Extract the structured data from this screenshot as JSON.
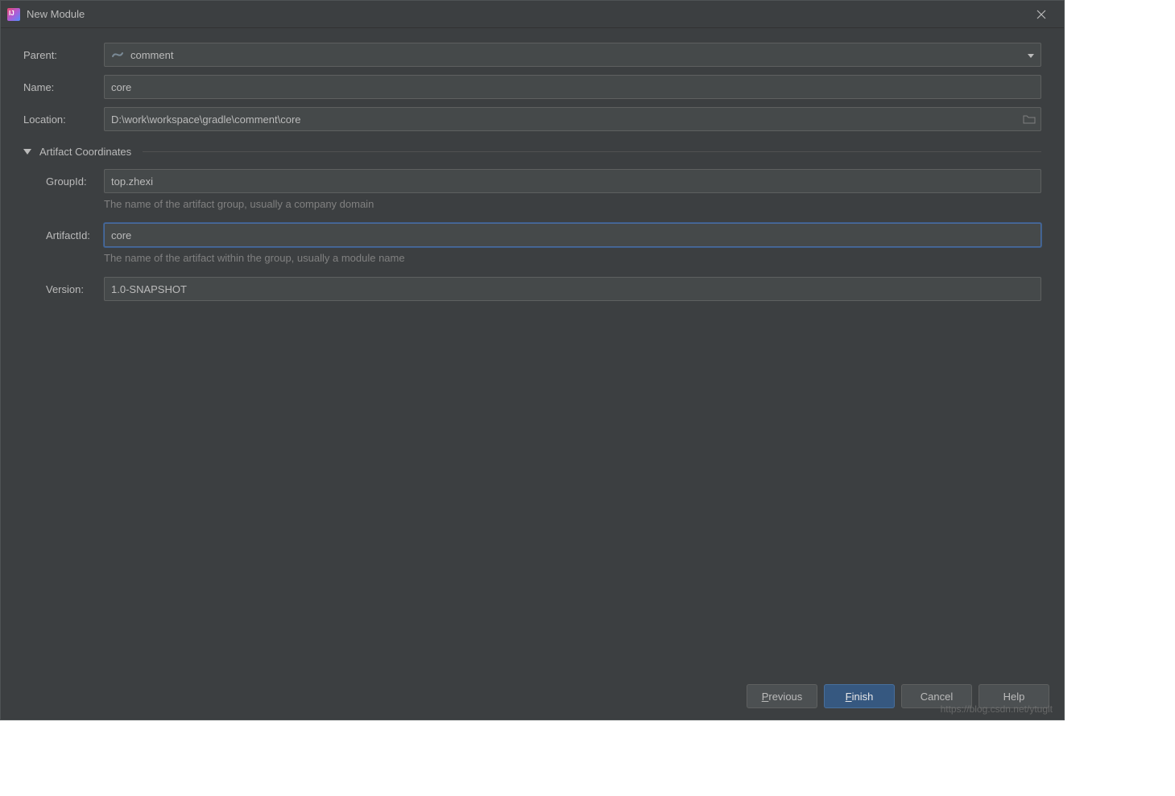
{
  "titlebar": {
    "title": "New Module"
  },
  "form": {
    "parent_label": "Parent:",
    "parent_value": "comment",
    "name_label": "Name:",
    "name_value": "core",
    "location_label": "Location:",
    "location_value": "D:\\work\\workspace\\gradle\\comment\\core"
  },
  "section": {
    "title": "Artifact Coordinates"
  },
  "artifact": {
    "group_label": "GroupId:",
    "group_value": "top.zhexi",
    "group_hint": "The name of the artifact group, usually a company domain",
    "artifact_label": "ArtifactId:",
    "artifact_value": "core",
    "artifact_hint": "The name of the artifact within the group, usually a module name",
    "version_label": "Version:",
    "version_value": "1.0-SNAPSHOT"
  },
  "buttons": {
    "previous": "revious",
    "finish": "inish",
    "cancel": "Cancel",
    "help": "Help"
  },
  "watermark": "https://blog.csdn.net/ytuglt"
}
